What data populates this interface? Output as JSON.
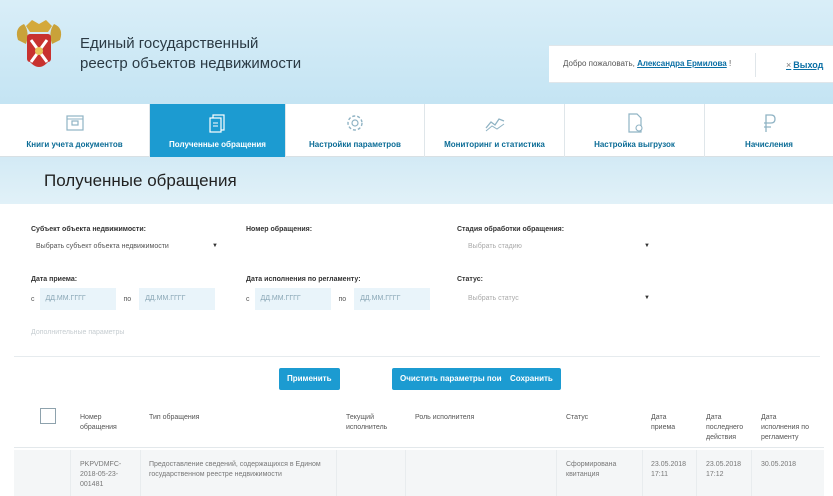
{
  "header": {
    "title_line1": "Единый государственный",
    "title_line2": "реестр объектов недвижимости",
    "welcome_text": "Добро пожаловать,",
    "user_name": "Александра Ермилова",
    "user_suffix": "!",
    "logout_label": "Выход"
  },
  "tabs": [
    {
      "label": "Книги учета документов",
      "icon": "ledger-icon"
    },
    {
      "label": "Полученные обращения",
      "icon": "documents-icon"
    },
    {
      "label": "Настройки параметров",
      "icon": "gear-icon"
    },
    {
      "label": "Мониторинг и статистика",
      "icon": "line-chart-icon"
    },
    {
      "label": "Настройка выгрузок",
      "icon": "export-file-icon"
    },
    {
      "label": "Начисления",
      "icon": "ruble-icon"
    }
  ],
  "page_title": "Полученные обращения",
  "filters": {
    "subject_label": "Субъект объекта недвижимости:",
    "subject_value": "Выбрать субъект объекта недвижимости",
    "request_number_label": "Номер обращения:",
    "stage_label": "Стадия обработки обращения:",
    "stage_placeholder": "Выбрать стадию",
    "receipt_date_label": "Дата приема:",
    "from_label": "с",
    "to_label": "по",
    "date_placeholder": "ДД.ММ.ГГГГ",
    "deadline_label": "Дата исполнения по регламенту:",
    "status_label": "Статус:",
    "status_placeholder": "Выбрать статус",
    "extra_params": "Дополнительные параметры"
  },
  "buttons": {
    "apply": "Применить",
    "clear": "Очистить параметры поиска",
    "save": "Сохранить"
  },
  "table": {
    "columns": {
      "number_1": "Номер",
      "number_2": "обращения",
      "type": "Тип обращения",
      "executor_1": "Текущий",
      "executor_2": "исполнитель",
      "role": "Роль исполнителя",
      "status": "Статус",
      "receipt_1": "Дата",
      "receipt_2": "приема",
      "last_1": "Дата",
      "last_2": "последнего",
      "last_3": "действия",
      "deadline_1": "Дата",
      "deadline_2": "исполнения по",
      "deadline_3": "регламенту"
    },
    "rows": [
      {
        "number_1": "PKPVDMFC-",
        "number_2": "2018-05-23-",
        "number_3": "001481",
        "type_1": "Предоставление сведений, содержащихся в Едином",
        "type_2": "государственном реестре недвижимости",
        "status_1": "Сформирована",
        "status_2": "квитанция",
        "receipt_1": "23.05.2018",
        "receipt_2": "17:11",
        "last_1": "23.05.2018",
        "last_2": "17:12",
        "deadline": "30.05.2018"
      }
    ]
  },
  "colors": {
    "accent": "#1c9bd1",
    "link": "#0a6fa5",
    "header_bg": "#d9eef8"
  }
}
